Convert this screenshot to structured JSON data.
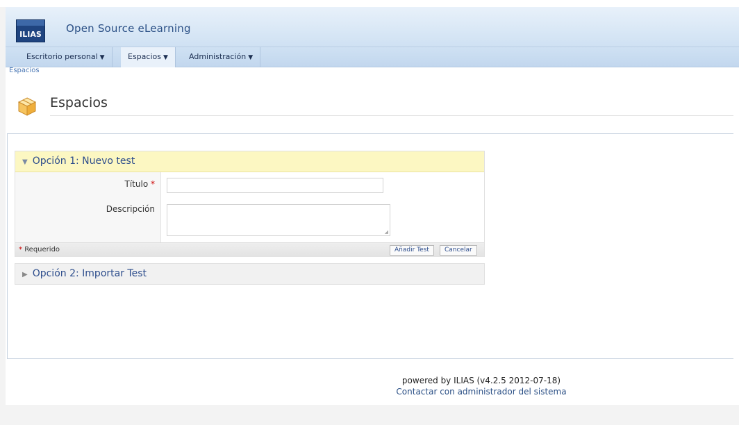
{
  "header": {
    "logo_text": "ILIAS",
    "site_title": "Open Source eLearning"
  },
  "mainmenu": {
    "items": [
      {
        "label": "Escritorio personal"
      },
      {
        "label": "Espacios"
      },
      {
        "label": "Administración"
      }
    ]
  },
  "breadcrumb": {
    "label": "Espacios"
  },
  "page": {
    "title": "Espacios"
  },
  "option1": {
    "header": "Opción 1: Nuevo test",
    "title_label": "Título",
    "required_mark": "*",
    "title_value": "",
    "description_label": "Descripción",
    "description_value": "",
    "required_note": "Requerido",
    "add_button": "Añadir Test",
    "cancel_button": "Cancelar"
  },
  "option2": {
    "header": "Opción 2: Importar Test"
  },
  "footer": {
    "powered_by": "powered by ILIAS (v4.2.5 2012-07-18)",
    "contact_link": "Contactar con administrador del sistema"
  },
  "colors": {
    "header_blue": "#cfe1f3",
    "link_blue": "#2d4d8c",
    "option_highlight": "#fcf7c2",
    "required_red": "#cc0000"
  }
}
